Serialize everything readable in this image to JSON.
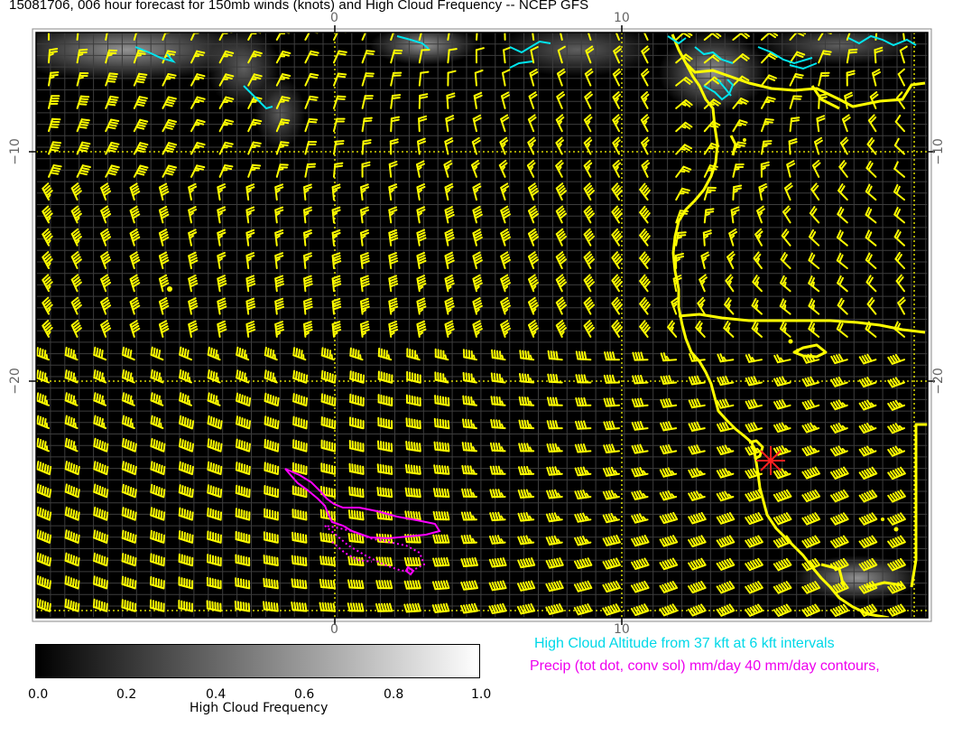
{
  "title": "15081706, 006 hour forecast for 150mb winds (knots) and High Cloud Frequency -- NCEP GFS",
  "map": {
    "x_ticks_top": [
      "0",
      "10"
    ],
    "x_ticks_bottom": [
      "0",
      "10"
    ],
    "y_ticks_left": [
      "−10",
      "−20"
    ],
    "y_ticks_right": [
      "−10",
      "−20"
    ],
    "background_color": "#000000",
    "barb_color": "#ffff00",
    "coast_color": "#ffff00",
    "cloud_altitude_color": "#00e5ee",
    "precip_color": "#ff00ff",
    "marker_color": "#ff2020"
  },
  "legend": {
    "cloud_altitude": "High Cloud Altitude from 37 kft at 6 kft intervals",
    "precip": "Precip (tot dot, conv sol) mm/day 40 mm/day contours,"
  },
  "colorbar": {
    "label": "High Cloud Frequency",
    "ticks": [
      "0.0",
      "0.2",
      "0.4",
      "0.6",
      "0.8",
      "1.0"
    ]
  }
}
